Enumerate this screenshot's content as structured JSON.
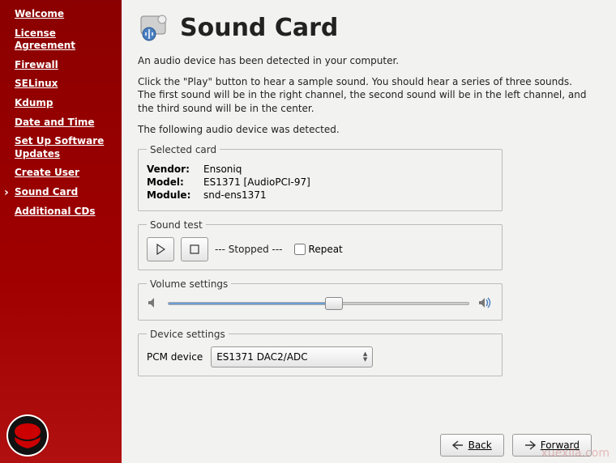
{
  "sidebar": {
    "items": [
      {
        "label": "Welcome"
      },
      {
        "label": "License Agreement"
      },
      {
        "label": "Firewall"
      },
      {
        "label": "SELinux"
      },
      {
        "label": "Kdump"
      },
      {
        "label": "Date and Time"
      },
      {
        "label": "Set Up Software Updates"
      },
      {
        "label": "Create User"
      },
      {
        "label": "Sound Card"
      },
      {
        "label": "Additional CDs"
      }
    ]
  },
  "header": {
    "title": "Sound Card",
    "icon": "sound-card-icon"
  },
  "description": {
    "line1": "An audio device has been detected in your computer.",
    "line2": "Click the \"Play\" button to hear a sample sound.  You should hear a series of three sounds.  The first sound will be in the right channel, the second sound will be in the left channel, and the third sound will be in the center.",
    "line3": "The following audio device was detected."
  },
  "selected_card": {
    "legend": "Selected card",
    "vendor_label": "Vendor:",
    "vendor_value": "Ensoniq",
    "model_label": "Model:",
    "model_value": "ES1371 [AudioPCI-97]",
    "module_label": "Module:",
    "module_value": "snd-ens1371"
  },
  "sound_test": {
    "legend": "Sound test",
    "status": "--- Stopped ---",
    "repeat_label": "Repeat",
    "repeat_checked": false
  },
  "volume": {
    "legend": "Volume settings",
    "percent": 55
  },
  "device": {
    "legend": "Device settings",
    "pcm_label": "PCM device",
    "selected": "ES1371 DAC2/ADC"
  },
  "footer": {
    "back": "Back",
    "forward": "Forward"
  },
  "watermark": "xuexila.com"
}
